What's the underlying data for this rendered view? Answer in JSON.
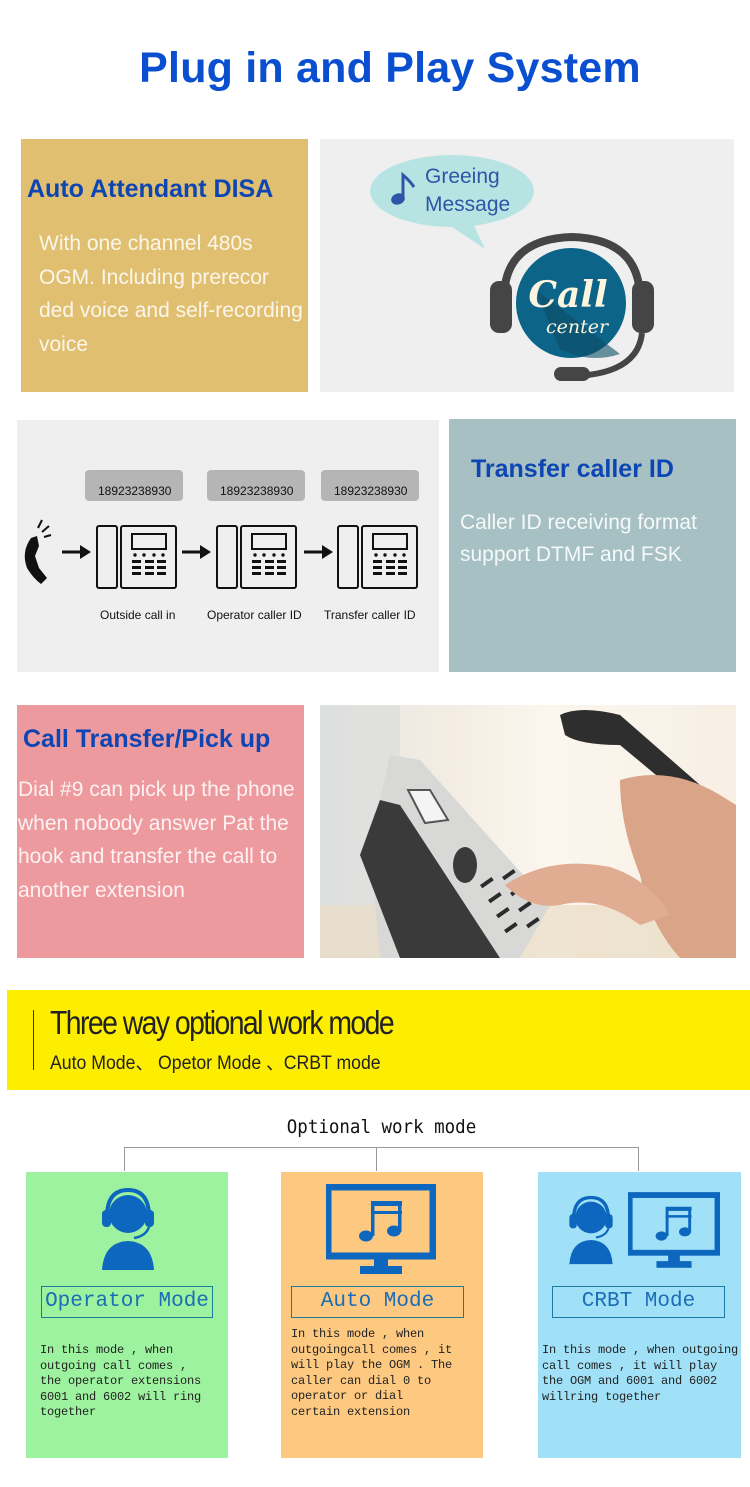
{
  "header": {
    "title": "Plug in and Play System"
  },
  "auto_attendant": {
    "title": "Auto Attendant DISA",
    "body": "With one channel 480s OGM. Including prerecor ded voice and self-recording voice",
    "colors": {
      "background": "#e1bf71",
      "title": "#0d45b3"
    }
  },
  "call_center_graphic": {
    "bubble_line1": "Greeing",
    "bubble_line2": "Message",
    "logo_line1": "Call",
    "logo_line2": "center",
    "icons": [
      "music-note-icon",
      "headset-icon"
    ]
  },
  "caller_id_diagram": {
    "steps": [
      {
        "number": "18923238930",
        "label": "Outside call in"
      },
      {
        "number": "18923238930",
        "label": "Operator caller ID"
      },
      {
        "number": "18923238930",
        "label": "Transfer caller ID"
      }
    ],
    "icons": [
      "ringing-handset-icon",
      "arrow-right-icon",
      "desk-phone-icon"
    ]
  },
  "transfer_caller_id": {
    "title": "Transfer caller ID",
    "body": "Caller ID receiving format support DTMF and FSK",
    "colors": {
      "background": "#a6c0c4"
    }
  },
  "call_transfer": {
    "title": "Call Transfer/Pick up",
    "body": "Dial #9 can pick up the phone when nobody answer Pat the hook and transfer the call to another extension",
    "colors": {
      "background": "#ed9a9f"
    }
  },
  "photo": {
    "alt": "hand dialing desk phone while holding handset"
  },
  "work_mode_banner": {
    "title": "Three way optional work mode",
    "subtitle": "Auto Mode、 Opetor Mode 、CRBT mode",
    "colors": {
      "background": "#fdee00"
    }
  },
  "mode_tree": {
    "title": "Optional work mode",
    "modes": [
      {
        "name": "Operator Mode",
        "icon": "operator-headset-icon",
        "description": "In this mode , when\noutgoing call comes ,\nthe operator extensions\n6001 and 6002 will ring\ntogether",
        "color": "#9df29f"
      },
      {
        "name": "Auto Mode",
        "icon": "monitor-music-icon",
        "description": "In this mode , when\noutgoingcall comes , it\nwill play the OGM . The\ncaller can dial 0 to\noperator or dial\ncertain extension",
        "color": "#fdc880"
      },
      {
        "name": "CRBT Mode",
        "icon": "operator-and-monitor-icon",
        "description": "In this mode , when outgoing\ncall comes , it will play\nthe OGM and 6001 and 6002\nwillring together",
        "color": "#a1e1f7"
      }
    ]
  }
}
